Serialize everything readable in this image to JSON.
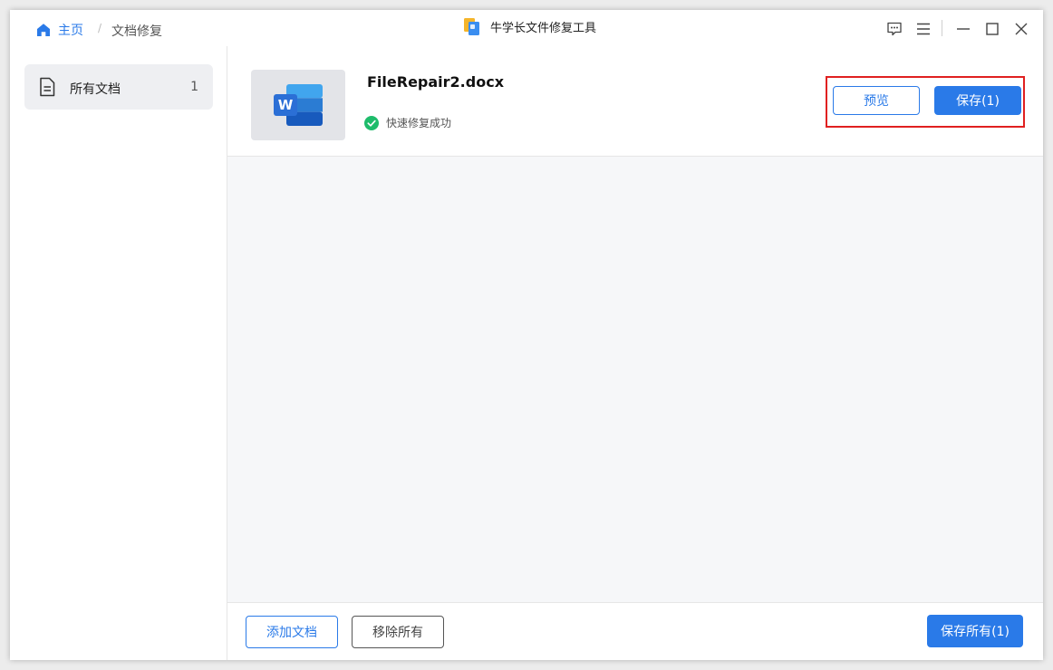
{
  "titlebar": {
    "home_label": "主页",
    "separator": "/",
    "current_label": "文档修复",
    "app_title": "牛学长文件修复工具",
    "icons": [
      "feedback-icon",
      "menu-icon",
      "minimize-icon",
      "maximize-icon",
      "close-icon"
    ]
  },
  "sidebar": {
    "items": [
      {
        "label": "所有文档",
        "count": "1",
        "icon": "document-icon"
      }
    ]
  },
  "file": {
    "name": "FileRepair2.docx",
    "status": "快速修复成功",
    "type_icon": "word-icon",
    "preview_label": "预览",
    "save_label": "保存(1)"
  },
  "footer": {
    "add_label": "添加文档",
    "remove_all_label": "移除所有",
    "save_all_label": "保存所有(1)"
  },
  "colors": {
    "accent": "#2a7ae8",
    "success": "#1ebc6b",
    "highlight": "#e02020",
    "sidebar_selected_bg": "#eeeff2"
  }
}
